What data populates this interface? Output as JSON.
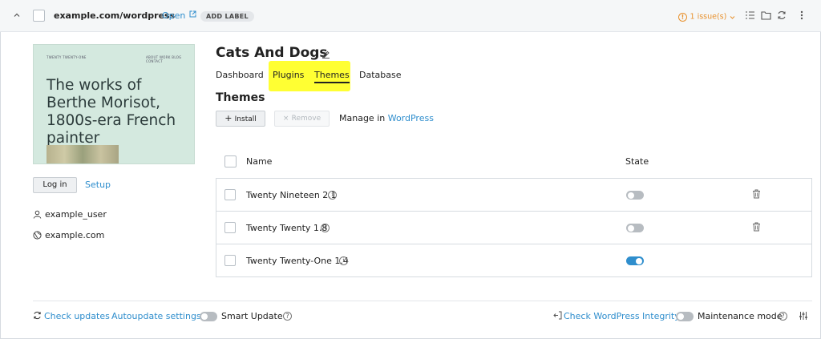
{
  "header": {
    "site_url": "example.com/wordpress",
    "open_label": "Open",
    "add_label": "ADD LABEL",
    "issues_label": "1 issue(s)",
    "issues_color": "#e8912d"
  },
  "preview": {
    "mini_title": "TWENTY TWENTY-ONE",
    "mini_nav": "ABOUT  WORK  BLOG  CONTACT",
    "heading": "The works of Berthe Morisot, 1800s-era French painter"
  },
  "sidebar": {
    "login_label": "Log in",
    "setup_label": "Setup",
    "username": "example_user",
    "domain": "example.com"
  },
  "site": {
    "title": "Cats And Dogs"
  },
  "tabs": [
    {
      "label": "Dashboard"
    },
    {
      "label": "Plugins"
    },
    {
      "label": "Themes"
    },
    {
      "label": "Database"
    }
  ],
  "themes": {
    "section_title": "Themes",
    "install_label": "Install",
    "remove_label": "Remove",
    "manage_prefix": "Manage in",
    "manage_link": "WordPress",
    "columns": {
      "name": "Name",
      "state": "State"
    },
    "rows": [
      {
        "name": "Twenty Nineteen 2.1",
        "active": false
      },
      {
        "name": "Twenty Twenty 1.8",
        "active": false
      },
      {
        "name": "Twenty Twenty-One 1.4",
        "active": true
      }
    ]
  },
  "footer": {
    "check_updates": "Check updates",
    "autoupdate_settings": "Autoupdate settings",
    "smart_update": "Smart Update",
    "check_integrity": "Check WordPress Integrity",
    "maintenance_mode": "Maintenance mode"
  },
  "colors": {
    "accent": "#2f8ecd",
    "highlight": "#ffff33"
  }
}
